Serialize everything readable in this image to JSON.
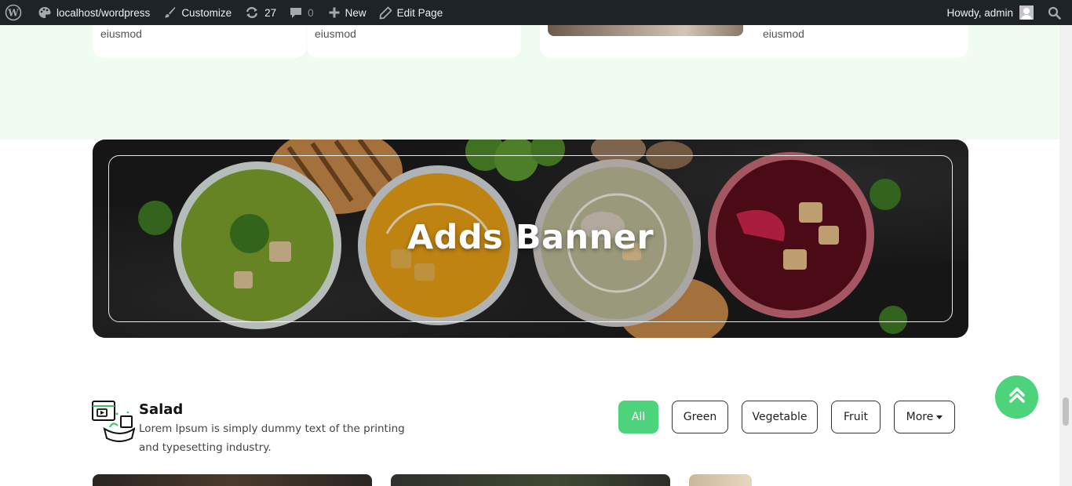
{
  "adminbar": {
    "site_name": "localhost/wordpress",
    "customize": "Customize",
    "updates_count": "27",
    "comments_count": "0",
    "new_label": "New",
    "edit_label": "Edit Page",
    "howdy": "Howdy, admin"
  },
  "cards": {
    "text_1": "eiusmod",
    "text_2": "eiusmod",
    "text_3": "eiusmod"
  },
  "banner": {
    "title": "Adds Banner"
  },
  "salad": {
    "title": "Salad",
    "description": "Lorem Ipsum is simply dummy text of the printing and typesetting industry."
  },
  "filters": {
    "all": "All",
    "green": "Green",
    "vegetable": "Vegetable",
    "fruit": "Fruit",
    "more": "More"
  },
  "colors": {
    "accent": "#4cd37b",
    "adminbar": "#1d2327",
    "mint_bg": "#f0fbf1"
  },
  "icons": [
    "wordpress-icon",
    "palette-icon",
    "brush-icon",
    "refresh-icon",
    "comment-icon",
    "plus-icon",
    "pencil-icon",
    "avatar-icon",
    "search-icon",
    "salad-video-icon",
    "double-chevron-up-icon"
  ]
}
